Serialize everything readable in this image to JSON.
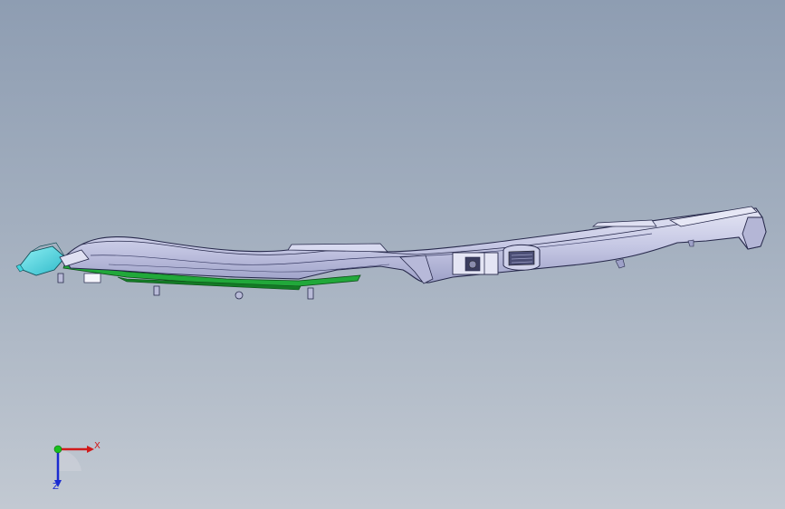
{
  "viewport": {
    "background_top": "#8e9db2",
    "background_bottom": "#c2c9d2"
  },
  "part": {
    "body_color": "#c9cbe6",
    "edge_color": "#26284a",
    "lower_trim_color": "#21a83a",
    "end_cap_color": "#3fd6e0",
    "icon": "instrument-panel-part"
  },
  "triad": {
    "x_label": "X",
    "z_label": "Z",
    "x_color": "#d11a1a",
    "y_color": "#19c01e",
    "z_color": "#1a2bd1"
  }
}
